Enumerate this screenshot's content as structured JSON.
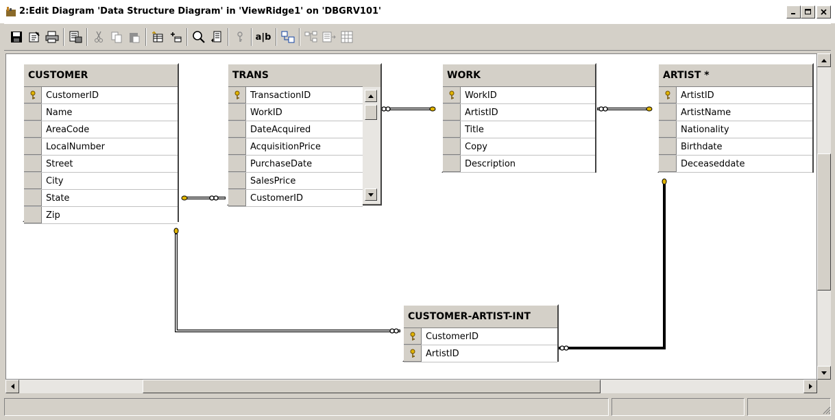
{
  "window": {
    "title": "2:Edit Diagram 'Data Structure Diagram' in 'ViewRidge1' on 'DBGRV101'",
    "controls": [
      "minimize",
      "maximize",
      "close"
    ]
  },
  "toolbar": {
    "buttons": [
      {
        "name": "save-icon"
      },
      {
        "name": "properties-icon"
      },
      {
        "name": "print-icon"
      },
      {
        "name": "generate-script-icon"
      },
      {
        "name": "cut-icon"
      },
      {
        "name": "copy-icon"
      },
      {
        "name": "paste-icon"
      },
      {
        "name": "new-table-icon"
      },
      {
        "name": "add-table-icon"
      },
      {
        "name": "zoom-icon"
      },
      {
        "name": "layout-icon"
      },
      {
        "name": "primary-key-icon"
      },
      {
        "name": "text-annotation-icon",
        "label": "a|b"
      },
      {
        "name": "table-view-icon"
      },
      {
        "name": "arrange-tables-icon"
      },
      {
        "name": "autosize-icon"
      },
      {
        "name": "page-breaks-icon"
      }
    ]
  },
  "diagram": {
    "tables": [
      {
        "name": "CUSTOMER",
        "columns": [
          {
            "name": "CustomerID",
            "key": true
          },
          {
            "name": "Name"
          },
          {
            "name": "AreaCode"
          },
          {
            "name": "LocalNumber"
          },
          {
            "name": "Street"
          },
          {
            "name": "City"
          },
          {
            "name": "State"
          },
          {
            "name": "Zip"
          }
        ]
      },
      {
        "name": "TRANS",
        "columns": [
          {
            "name": "TransactionID",
            "key": true
          },
          {
            "name": "WorkID"
          },
          {
            "name": "DateAcquired"
          },
          {
            "name": "AcquisitionPrice"
          },
          {
            "name": "PurchaseDate"
          },
          {
            "name": "SalesPrice"
          },
          {
            "name": "CustomerID"
          }
        ]
      },
      {
        "name": "WORK",
        "columns": [
          {
            "name": "WorkID",
            "key": true
          },
          {
            "name": "ArtistID"
          },
          {
            "name": "Title"
          },
          {
            "name": "Copy"
          },
          {
            "name": "Description"
          }
        ]
      },
      {
        "name": "ARTIST *",
        "columns": [
          {
            "name": "ArtistID",
            "key": true
          },
          {
            "name": "ArtistName"
          },
          {
            "name": "Nationality"
          },
          {
            "name": "Birthdate"
          },
          {
            "name": "Deceaseddate"
          }
        ]
      },
      {
        "name": "CUSTOMER-ARTIST-INT",
        "columns": [
          {
            "name": "CustomerID",
            "key": true
          },
          {
            "name": "ArtistID",
            "key": true
          }
        ]
      }
    ],
    "relationships": [
      {
        "from": "CUSTOMER",
        "to": "TRANS"
      },
      {
        "from": "WORK",
        "to": "TRANS"
      },
      {
        "from": "ARTIST *",
        "to": "WORK"
      },
      {
        "from": "CUSTOMER",
        "to": "CUSTOMER-ARTIST-INT"
      },
      {
        "from": "ARTIST *",
        "to": "CUSTOMER-ARTIST-INT"
      }
    ]
  },
  "colors": {
    "key": "#e0b400",
    "face": "#d4d0c8",
    "canvas": "#ffffff"
  }
}
